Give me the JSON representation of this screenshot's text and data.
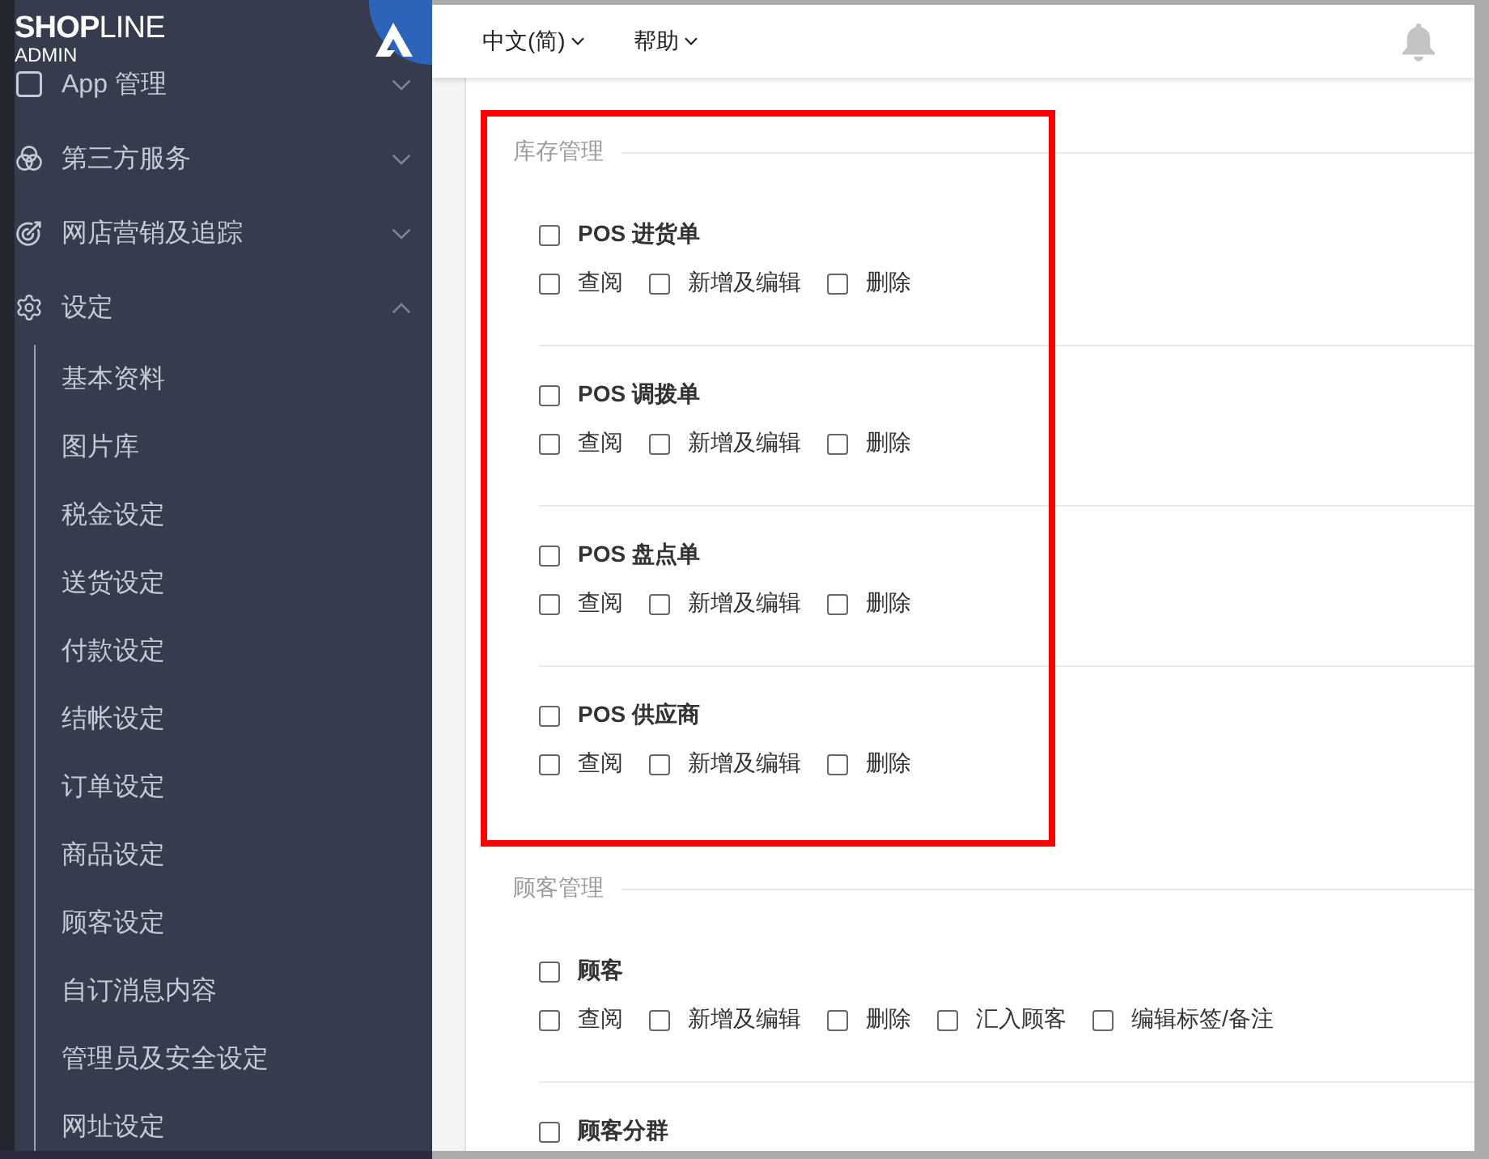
{
  "sidebar": {
    "logo": {
      "wordmark": "**SHOP**LINE",
      "subtitle": "ADMIN"
    },
    "items": [
      {
        "label": "App 管理",
        "expanded": false
      },
      {
        "label": "第三方服务",
        "expanded": false
      },
      {
        "label": "网店营销及追踪",
        "expanded": false
      },
      {
        "label": "设定",
        "expanded": true,
        "children": [
          {
            "label": "基本资料",
            "selected": false
          },
          {
            "label": "图片库",
            "selected": false
          },
          {
            "label": "税金设定",
            "selected": false
          },
          {
            "label": "送货设定",
            "selected": false
          },
          {
            "label": "付款设定",
            "selected": false
          },
          {
            "label": "结帐设定",
            "selected": false
          },
          {
            "label": "订单设定",
            "selected": false
          },
          {
            "label": "商品设定",
            "selected": false
          },
          {
            "label": "顾客设定",
            "selected": false
          },
          {
            "label": "自订消息内容",
            "selected": false
          },
          {
            "label": "管理员及安全设定",
            "selected": false
          },
          {
            "label": "网址设定",
            "selected": false
          }
        ]
      }
    ]
  },
  "topbar": {
    "menus": [
      {
        "label": "中文(简)"
      },
      {
        "label": "帮助"
      }
    ]
  },
  "sections": [
    {
      "title": "库存管理",
      "highlighted": true,
      "groups": [
        {
          "label": "POS 进货单",
          "checked": false,
          "permissions": [
            {
              "label": "查阅",
              "checked": false
            },
            {
              "label": "新增及编辑",
              "checked": false
            },
            {
              "label": "删除",
              "checked": false
            }
          ]
        },
        {
          "label": "POS 调拨单",
          "checked": false,
          "permissions": [
            {
              "label": "查阅",
              "checked": false
            },
            {
              "label": "新增及编辑",
              "checked": false
            },
            {
              "label": "删除",
              "checked": false
            }
          ]
        },
        {
          "label": "POS 盘点单",
          "checked": false,
          "permissions": [
            {
              "label": "查阅",
              "checked": false
            },
            {
              "label": "新增及编辑",
              "checked": false
            },
            {
              "label": "删除",
              "checked": false
            }
          ]
        },
        {
          "label": "POS 供应商",
          "checked": false,
          "permissions": [
            {
              "label": "查阅",
              "checked": false
            },
            {
              "label": "新增及编辑",
              "checked": false
            },
            {
              "label": "删除",
              "checked": false
            }
          ]
        }
      ]
    },
    {
      "title": "顾客管理",
      "highlighted": false,
      "groups": [
        {
          "label": "顾客",
          "checked": false,
          "permissions": [
            {
              "label": "查阅",
              "checked": false
            },
            {
              "label": "新增及编辑",
              "checked": false
            },
            {
              "label": "删除",
              "checked": false
            },
            {
              "label": "汇入顾客",
              "checked": false
            },
            {
              "label": "编辑标签/备注",
              "checked": false
            }
          ]
        },
        {
          "label": "顾客分群",
          "checked": false
        }
      ]
    }
  ]
}
